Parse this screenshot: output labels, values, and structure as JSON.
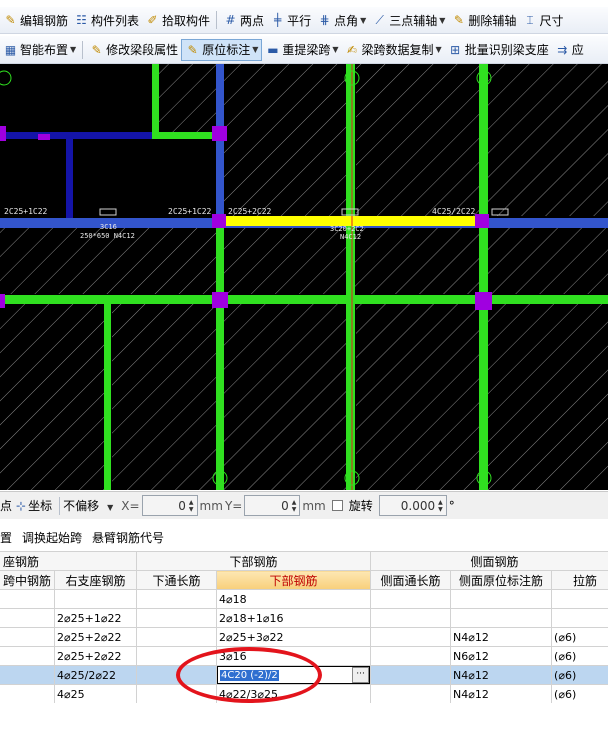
{
  "toolbar1": {
    "items": [
      {
        "label": "编辑钢筋",
        "icon": "edit-rebar-icon"
      },
      {
        "label": "构件列表",
        "icon": "component-list-icon"
      },
      {
        "label": "拾取构件",
        "icon": "pick-component-icon"
      },
      {
        "label": "两点",
        "icon": "two-point-axis-icon"
      },
      {
        "label": "平行",
        "icon": "parallel-axis-icon"
      },
      {
        "label": "点角",
        "icon": "point-angle-icon"
      },
      {
        "label": "三点辅轴",
        "icon": "three-point-axis-icon"
      },
      {
        "label": "删除辅轴",
        "icon": "delete-axis-icon"
      },
      {
        "label": "尺寸",
        "icon": "dimension-icon"
      }
    ]
  },
  "toolbar2": {
    "items": [
      {
        "label": "智能布置",
        "icon": "smart-layout-icon"
      },
      {
        "label": "修改梁段属性",
        "icon": "modify-beam-icon"
      },
      {
        "label": "原位标注",
        "icon": "in-situ-label-icon"
      },
      {
        "label": "重提梁跨",
        "icon": "re-extract-span-icon"
      },
      {
        "label": "梁跨数据复制",
        "icon": "copy-span-data-icon"
      },
      {
        "label": "批量识别梁支座",
        "icon": "batch-support-icon"
      },
      {
        "label": "应",
        "icon": "apply-icon"
      }
    ]
  },
  "canvas": {
    "labels": [
      "2C25+1C22",
      "2C25+1C22",
      "2C25+2C22",
      "4C25/2C22",
      "3C16",
      "250*650 N4C12",
      "3C20+2C2",
      "N4C12"
    ]
  },
  "coordbar": {
    "point": "点",
    "coord": "坐标",
    "offset": "不偏移",
    "x_label": "X=",
    "x_value": "0",
    "y_label": "Y=",
    "y_value": "0",
    "unit": "mm",
    "rotate_label": "旋转",
    "rotate_value": "0.000",
    "degree": "°"
  },
  "rowtools": {
    "items": [
      "置",
      "调换起始跨",
      "悬臂钢筋代号"
    ]
  },
  "grid": {
    "groups": [
      "座钢筋",
      "下部钢筋",
      "侧面钢筋"
    ],
    "columns": [
      "跨中钢筋",
      "右支座钢筋",
      "下通长筋",
      "下部钢筋",
      "侧面通长筋",
      "侧面原位标注筋",
      "拉筋"
    ],
    "rows": [
      [
        "",
        "",
        "",
        "4⌀18",
        "",
        "",
        ""
      ],
      [
        "",
        "2⌀25+1⌀22",
        "",
        "2⌀18+1⌀16",
        "",
        "",
        ""
      ],
      [
        "",
        "2⌀25+2⌀22",
        "",
        "2⌀25+3⌀22",
        "",
        "N4⌀12",
        "(⌀6)"
      ],
      [
        "",
        "2⌀25+2⌀22",
        "",
        "3⌀16",
        "",
        "N6⌀12",
        "(⌀6)"
      ],
      [
        "",
        "4⌀25/2⌀22",
        "",
        "4C20 (-2)/2",
        "",
        "N4⌀12",
        "(⌀6)"
      ],
      [
        "",
        "4⌀25",
        "",
        "4⌀22/3⌀25",
        "",
        "N4⌀12",
        "(⌀6)"
      ]
    ],
    "selected_row": 4,
    "editing_value": "4C20 (-2)/2",
    "edit_button": "···"
  }
}
